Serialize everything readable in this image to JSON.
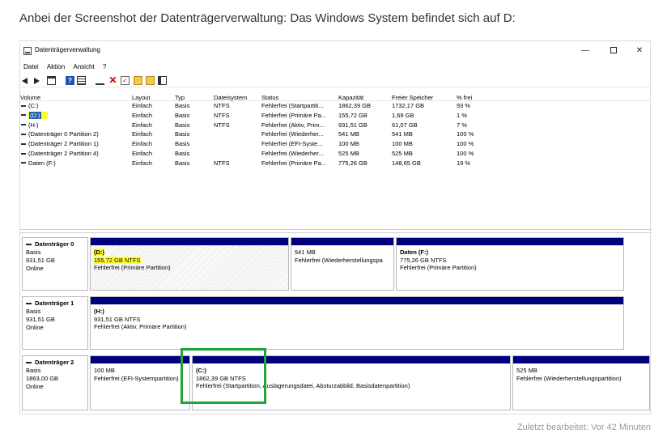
{
  "post": {
    "title": "Anbei der Screenshot der Datenträgerverwaltung: Das Windows System befindet sich auf D:",
    "footer": "Zuletzt bearbeitet: Vor 42 Minuten"
  },
  "window": {
    "title": "Datenträgerverwaltung",
    "controls": {
      "minimize": "—",
      "maximize": "",
      "close": "✕"
    },
    "menu": [
      "Datei",
      "Aktion",
      "Ansicht",
      "?"
    ],
    "toolbar": [
      "back-icon",
      "forward-icon",
      "list-icon",
      "help-icon",
      "grid-icon",
      "connect-icon",
      "delete-icon",
      "check-icon",
      "folder-icon",
      "folder-icon",
      "properties-icon"
    ]
  },
  "volume_table": {
    "columns": [
      "Volume",
      "Layout",
      "Typ",
      "Dateisystem",
      "Status",
      "Kapazität",
      "Freier Speicher",
      "% frei"
    ],
    "rows": [
      [
        "(C:)",
        "Einfach",
        "Basis",
        "NTFS",
        "Fehlerfrei (Startpartiti...",
        "1862,39 GB",
        "1732,17 GB",
        "93 %"
      ],
      [
        "(D:)",
        "Einfach",
        "Basis",
        "NTFS",
        "Fehlerfrei (Primäre Pa...",
        "155,72 GB",
        "1,69 GB",
        "1 %"
      ],
      [
        "(H:)",
        "Einfach",
        "Basis",
        "NTFS",
        "Fehlerfrei (Aktiv, Prim...",
        "931,51 GB",
        "61,07 GB",
        "7 %"
      ],
      [
        "(Datenträger 0 Partition 2)",
        "Einfach",
        "Basis",
        "",
        "Fehlerfrei (Wiederher...",
        "541 MB",
        "541 MB",
        "100 %"
      ],
      [
        "(Datenträger 2 Partition 1)",
        "Einfach",
        "Basis",
        "",
        "Fehlerfrei (EFI-Syste...",
        "100 MB",
        "100 MB",
        "100 %"
      ],
      [
        "(Datenträger 2 Partition 4)",
        "Einfach",
        "Basis",
        "",
        "Fehlerfrei (Wiederher...",
        "525 MB",
        "525 MB",
        "100 %"
      ],
      [
        "Daten (F:)",
        "Einfach",
        "Basis",
        "NTFS",
        "Fehlerfrei (Primäre Pa...",
        "775,26 GB",
        "148,65 GB",
        "19 %"
      ]
    ]
  },
  "disks": [
    {
      "name": "Datenträger 0",
      "type": "Basis",
      "size": "931,51 GB",
      "status": "Online",
      "partitions": [
        {
          "title": "(D:)",
          "size": "155,72 GB NTFS",
          "status": "Fehlerfrei (Primäre Partition)"
        },
        {
          "title": "",
          "size": "541 MB",
          "status": "Fehlerfrei (Wiederherstellungspa"
        },
        {
          "title": "Daten  (F:)",
          "size": "775,26 GB NTFS",
          "status": "Fehlerfrei (Primäre Partition)"
        }
      ]
    },
    {
      "name": "Datenträger 1",
      "type": "Basis",
      "size": "931,51 GB",
      "status": "Online",
      "partitions": [
        {
          "title": "(H:)",
          "size": "931,51 GB NTFS",
          "status": "Fehlerfrei (Aktiv, Primäre Partition)"
        }
      ]
    },
    {
      "name": "Datenträger 2",
      "type": "Basis",
      "size": "1863,00 GB",
      "status": "Online",
      "partitions": [
        {
          "title": "",
          "size": "100 MB",
          "status": "Fehlerfrei (EFI-Systempartition)"
        },
        {
          "title": "(C:)",
          "size": "1862,39 GB NTFS",
          "status": "Fehlerfrei (Startpartition, Auslagerungsdatei, Absturzabbild, Basisdatenpartition)"
        },
        {
          "title": "",
          "size": "525 MB",
          "status": "Fehlerfrei (Wiederherstellungspartition)"
        }
      ]
    }
  ],
  "colors": {
    "partition_band": "#00007c",
    "highlight_yellow": "#ffff2e",
    "annotation_green": "#1fa33a",
    "selection_blue": "#1f5fa8"
  }
}
